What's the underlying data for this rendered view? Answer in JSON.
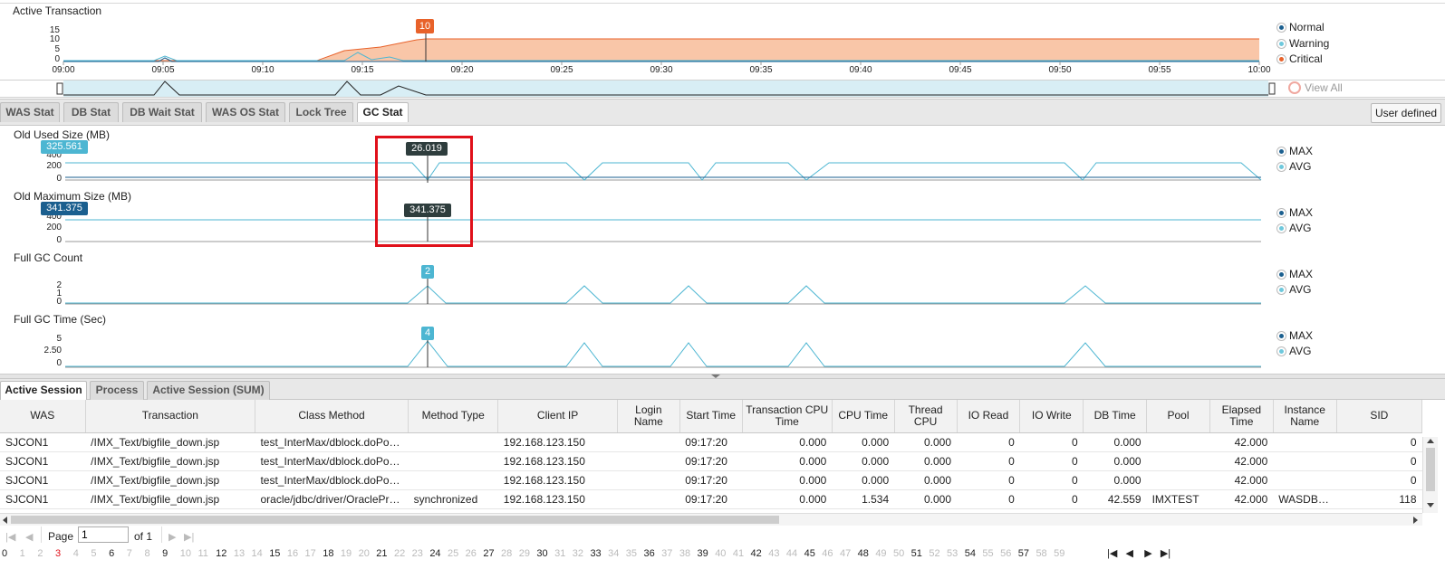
{
  "active_transaction": {
    "title": "Active Transaction",
    "y_ticks": [
      "15",
      "10",
      "5",
      "0"
    ],
    "x_ticks": [
      "09:00",
      "09:05",
      "09:10",
      "09:15",
      "09:20",
      "09:25",
      "09:30",
      "09:35",
      "09:40",
      "09:45",
      "09:50",
      "09:55",
      "10:00"
    ],
    "marker_value": "10",
    "legend": [
      {
        "label": "Normal",
        "color": "#1b5f8f"
      },
      {
        "label": "Warning",
        "color": "#6ec8dc"
      },
      {
        "label": "Critical",
        "color": "#e8622a"
      }
    ],
    "colors": {
      "critical_fill": "#f9c6a8",
      "critical_line": "#e8622a",
      "warning_line": "#4db6d2",
      "marker": "#e8622a"
    }
  },
  "view_all_label": "View  All",
  "stat_tabs": [
    {
      "label": "WAS Stat",
      "active": false
    },
    {
      "label": "DB Stat",
      "active": false
    },
    {
      "label": "DB Wait Stat",
      "active": false
    },
    {
      "label": "WAS OS Stat",
      "active": false
    },
    {
      "label": "Lock Tree",
      "active": false
    },
    {
      "label": "GC Stat",
      "active": true
    }
  ],
  "user_defined_label": "User defined",
  "gc_charts": [
    {
      "title": "Old Used Size (MB)",
      "y_ticks": [
        "400",
        "200",
        "0"
      ],
      "current_value": "325.561",
      "cursor_value": "26.019",
      "legend": [
        "MAX",
        "AVG"
      ]
    },
    {
      "title": "Old Maximum Size (MB)",
      "y_ticks": [
        "400",
        "200",
        "0"
      ],
      "current_value": "341.375",
      "cursor_value": "341.375",
      "legend": [
        "MAX",
        "AVG"
      ]
    },
    {
      "title": "Full GC Count",
      "y_ticks": [
        "2",
        "1",
        "0"
      ],
      "cursor_value": "2",
      "legend": [
        "MAX",
        "AVG"
      ]
    },
    {
      "title": "Full GC Time (Sec)",
      "y_ticks": [
        "5",
        "2.50",
        "0"
      ],
      "cursor_value": "4",
      "legend": [
        "MAX",
        "AVG"
      ]
    }
  ],
  "gc_colors": {
    "max": "#1b5f8f",
    "avg": "#6ec8dc",
    "line": "#4db6d2",
    "highlight": "#e0101a"
  },
  "session_tabs": [
    {
      "label": "Active Session",
      "active": true
    },
    {
      "label": "Process",
      "active": false
    },
    {
      "label": "Active Session (SUM)",
      "active": false
    }
  ],
  "table": {
    "columns": [
      "WAS",
      "Transaction",
      "Class Method",
      "Method Type",
      "Client IP",
      "Login Name",
      "Start Time",
      "Transaction CPU Time",
      "CPU Time",
      "Thread CPU",
      "IO Read",
      "IO Write",
      "DB Time",
      "Pool",
      "Elapsed Time",
      "Instance Name",
      "SID"
    ],
    "rows": [
      [
        "SJCON1",
        "/IMX_Text/bigfile_down.jsp",
        "test_InterMax/dblock.doPos...",
        "",
        "192.168.123.150",
        "",
        "09:17:20",
        "0.000",
        "0.000",
        "0.000",
        "0",
        "0",
        "0.000",
        "",
        "42.000",
        "",
        "0"
      ],
      [
        "SJCON1",
        "/IMX_Text/bigfile_down.jsp",
        "test_InterMax/dblock.doPos...",
        "",
        "192.168.123.150",
        "",
        "09:17:20",
        "0.000",
        "0.000",
        "0.000",
        "0",
        "0",
        "0.000",
        "",
        "42.000",
        "",
        "0"
      ],
      [
        "SJCON1",
        "/IMX_Text/bigfile_down.jsp",
        "test_InterMax/dblock.doPos...",
        "",
        "192.168.123.150",
        "",
        "09:17:20",
        "0.000",
        "0.000",
        "0.000",
        "0",
        "0",
        "0.000",
        "",
        "42.000",
        "",
        "0"
      ],
      [
        "SJCON1",
        "/IMX_Text/bigfile_down.jsp",
        "oracle/jdbc/driver/OraclePre...",
        "synchronized",
        "192.168.123.150",
        "",
        "09:17:20",
        "0.000",
        "1.534",
        "0.000",
        "0",
        "0",
        "42.559",
        "IMXTEST",
        "42.000",
        "WASDB3...",
        "118"
      ]
    ]
  },
  "pager": {
    "page_label": "Page",
    "page_value": "1",
    "of_label": "of 1"
  },
  "timeline_numbers": [
    "0",
    "1",
    "2",
    "3",
    "4",
    "5",
    "6",
    "7",
    "8",
    "9",
    "10",
    "11",
    "12",
    "13",
    "14",
    "15",
    "16",
    "17",
    "18",
    "19",
    "20",
    "21",
    "22",
    "23",
    "24",
    "25",
    "26",
    "27",
    "28",
    "29",
    "30",
    "31",
    "32",
    "33",
    "34",
    "35",
    "36",
    "37",
    "38",
    "39",
    "40",
    "41",
    "42",
    "43",
    "44",
    "45",
    "46",
    "47",
    "48",
    "49",
    "50",
    "51",
    "52",
    "53",
    "54",
    "55",
    "56",
    "57",
    "58",
    "59"
  ],
  "timeline_dark": [
    "0",
    "3",
    "6",
    "9",
    "12",
    "15",
    "18",
    "21",
    "24",
    "27",
    "30",
    "33",
    "36",
    "39",
    "42",
    "45",
    "48",
    "51",
    "54",
    "57"
  ],
  "timeline_red": [
    "3"
  ]
}
